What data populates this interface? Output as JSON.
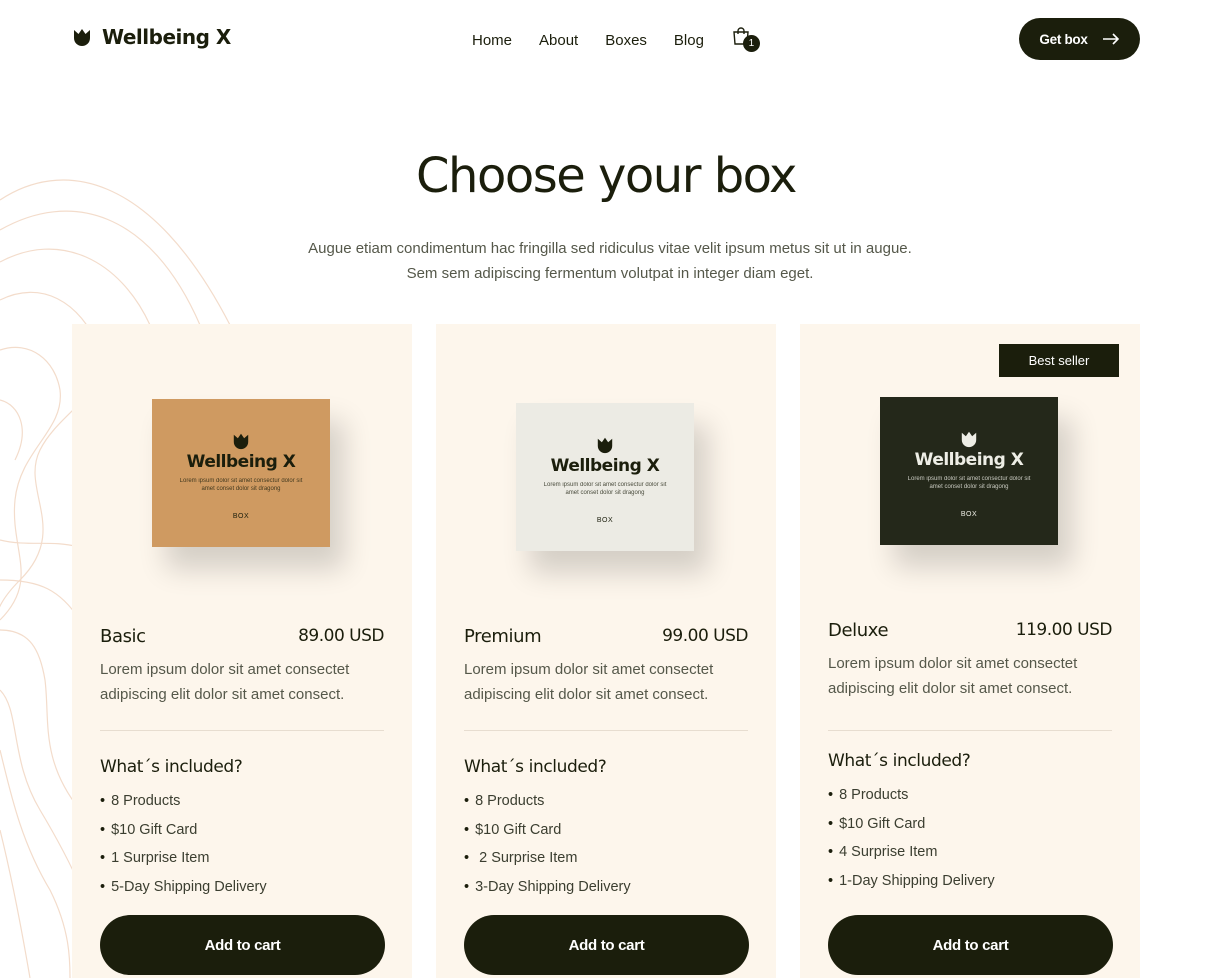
{
  "brand": {
    "name": "Wellbeing X",
    "logo_icon": "tulip-icon",
    "dark": "#1b1e0c",
    "cream": "#fdf6ec"
  },
  "nav": {
    "items": [
      "Home",
      "About",
      "Boxes",
      "Blog"
    ],
    "cart_icon": "shopping-bag-icon",
    "cart_count": "1",
    "cta_label": "Get box",
    "cta_icon": "arrow-right-icon"
  },
  "hero": {
    "title": "Choose your box",
    "subtitle": "Augue etiam condimentum hac fringilla sed ridiculus vitae velit ipsum metus sit ut in augue. Sem sem adipiscing fermentum volutpat in integer diam eget."
  },
  "cards": [
    {
      "name": "Basic",
      "price": "89.00 USD",
      "description": "Lorem ipsum dolor sit amet consectet adipiscing elit dolor sit amet consect.",
      "included_title": "What´s included?",
      "features": [
        "8 Products",
        "$10 Gift Card",
        "1 Surprise Item",
        "5-Day Shipping Delivery"
      ],
      "button": "Add to cart",
      "box": {
        "title": "Wellbeing X",
        "fine_print": "Lorem ipsum dolor sit amet consectur dolor sit amet conset dolor sit dragong",
        "label": "BOX",
        "color": "#cf9a61"
      }
    },
    {
      "name": "Premium",
      "price": "99.00 USD",
      "description": "Lorem ipsum dolor sit amet consectet adipiscing elit dolor sit amet consect.",
      "included_title": "What´s included?",
      "features": [
        "8 Products",
        "$10 Gift Card",
        " 2 Surprise Item",
        "3-Day Shipping Delivery"
      ],
      "button": "Add to cart",
      "box": {
        "title": "Wellbeing X",
        "fine_print": "Lorem ipsum dolor sit amet consectur dolor sit amet conset dolor sit dragong",
        "label": "BOX",
        "color": "#ecebe4"
      }
    },
    {
      "name": "Deluxe",
      "price": "119.00 USD",
      "badge": "Best seller",
      "description": "Lorem ipsum dolor sit amet consectet adipiscing elit dolor sit amet consect.",
      "included_title": "What´s included?",
      "features": [
        "8 Products",
        "$10 Gift Card",
        "4 Surprise Item",
        "1-Day Shipping Delivery"
      ],
      "button": "Add to cart",
      "box": {
        "title": "Wellbeing X",
        "fine_print": "Lorem ipsum dolor sit amet consectur dolor sit amet conset dolor sit dragong",
        "label": "BOX",
        "color": "#24281a"
      }
    }
  ]
}
